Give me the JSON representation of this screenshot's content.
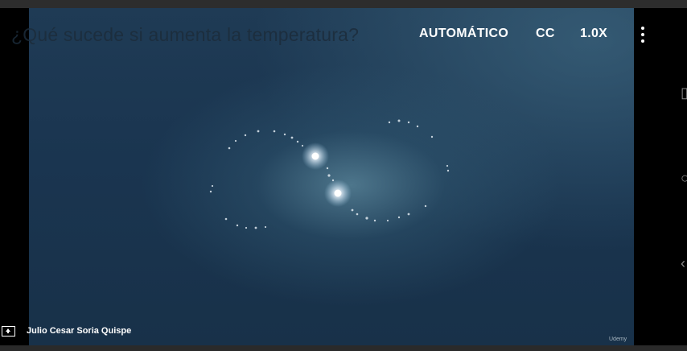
{
  "video": {
    "title": "¿Qué sucede si aumenta la temperatura?",
    "watermark": "Udemy"
  },
  "controls": {
    "quality_label": "AUTOMÁTICO",
    "captions_label": "CC",
    "speed_label": "1.0X",
    "more_icon": "vertical-dots-icon"
  },
  "presenter": {
    "name": "Julio Cesar Soria Quispe",
    "fullscreen_icon": "expand-icon"
  },
  "colors": {
    "background": "#000000",
    "video_dark": "#183149",
    "video_glow": "#5f8ca0",
    "text": "#ffffff"
  }
}
